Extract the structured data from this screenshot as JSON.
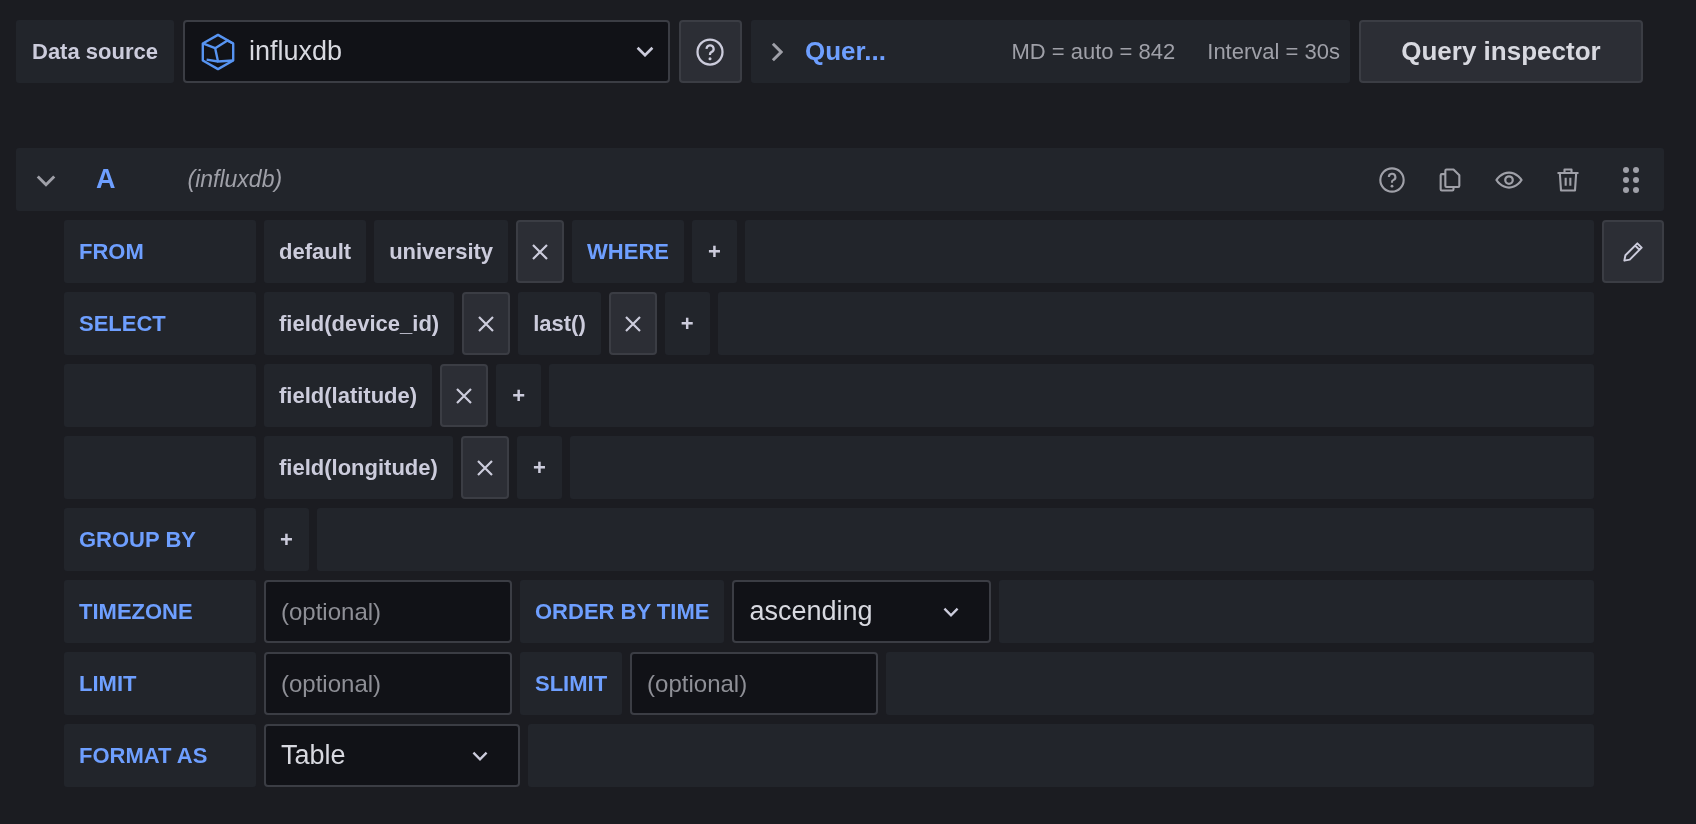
{
  "data_source": {
    "label": "Data source",
    "value": "influxdb"
  },
  "query_options": {
    "expanded": false,
    "title": "Quer...",
    "max_data_points": "MD = auto = 842",
    "interval": "Interval = 30s"
  },
  "query_inspector": "Query inspector",
  "query": {
    "ref_id": "A",
    "datasource": "(influxdb)",
    "expanded": true,
    "rows": [
      {
        "label": "FROM",
        "raw_edit_toggle": true,
        "items": [
          {
            "kind": "segment",
            "text": "default"
          },
          {
            "kind": "segment",
            "text": "university"
          },
          {
            "kind": "remove"
          },
          {
            "kind": "keyword",
            "text": "WHERE"
          },
          {
            "kind": "add",
            "text": "+"
          }
        ]
      },
      {
        "label": "SELECT",
        "raw_edit_toggle": false,
        "items": [
          {
            "kind": "segment",
            "text": "field(device_id)"
          },
          {
            "kind": "remove"
          },
          {
            "kind": "segment",
            "text": "last()"
          },
          {
            "kind": "remove"
          },
          {
            "kind": "add",
            "text": "+"
          }
        ]
      },
      {
        "label": "",
        "raw_edit_toggle": false,
        "items": [
          {
            "kind": "segment",
            "text": "field(latitude)"
          },
          {
            "kind": "remove"
          },
          {
            "kind": "add",
            "text": "+"
          }
        ]
      },
      {
        "label": "",
        "raw_edit_toggle": false,
        "items": [
          {
            "kind": "segment",
            "text": "field(longitude)"
          },
          {
            "kind": "remove"
          },
          {
            "kind": "add",
            "text": "+"
          }
        ]
      },
      {
        "label": "GROUP BY",
        "raw_edit_toggle": false,
        "items": [
          {
            "kind": "add",
            "text": "+"
          }
        ]
      },
      {
        "label": "TIMEZONE",
        "raw_edit_toggle": false,
        "items": [
          {
            "kind": "input",
            "placeholder": "(optional)"
          },
          {
            "kind": "keyword",
            "text": "ORDER BY TIME"
          },
          {
            "kind": "select",
            "value": "ascending"
          }
        ]
      },
      {
        "label": "LIMIT",
        "raw_edit_toggle": false,
        "items": [
          {
            "kind": "input",
            "placeholder": "(optional)"
          },
          {
            "kind": "keyword",
            "text": "SLIMIT"
          },
          {
            "kind": "input",
            "placeholder": "(optional)"
          }
        ]
      },
      {
        "label": "FORMAT AS",
        "raw_edit_toggle": false,
        "items": [
          {
            "kind": "select",
            "value": "Table"
          }
        ]
      }
    ]
  }
}
